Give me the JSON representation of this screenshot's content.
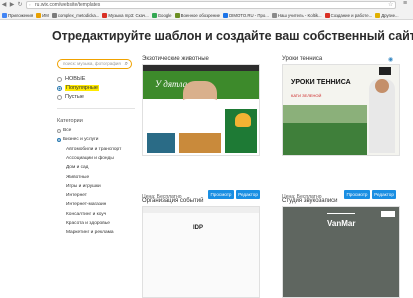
{
  "browser": {
    "url": "ru.wix.com/website/templates",
    "bookmarks": [
      {
        "label": "Приложения",
        "color": "#4285f4"
      },
      {
        "label": "ИМ",
        "color": "#e8a000"
      },
      {
        "label": "complex_metodicka...",
        "color": "#7b7b7b"
      },
      {
        "label": "Музыка mp3: Скач...",
        "color": "#d93025"
      },
      {
        "label": "Google",
        "color": "#34a853"
      },
      {
        "label": "Военное обозрение",
        "color": "#6b8e23"
      },
      {
        "label": "DIMOTO.RU - Про...",
        "color": "#1a73e8"
      },
      {
        "label": "Наш учитель - Koltik...",
        "color": "#8a8a8a"
      },
      {
        "label": "Создание и работе...",
        "color": "#d93025"
      },
      {
        "label": "Другие...",
        "color": "#e0b000"
      }
    ]
  },
  "headline": "Отредактируйте шаблон и создайте ваш собственный сайт!",
  "sidebar": {
    "search_placeholder": "поиск: музыка, фотография",
    "filters": [
      {
        "label": "НОВЫЕ",
        "selected": false,
        "highlight": false
      },
      {
        "label": "Популярные",
        "selected": true,
        "highlight": true
      },
      {
        "label": "Пустые",
        "selected": false,
        "highlight": false
      }
    ],
    "categories_title": "Категории",
    "categories": [
      {
        "label": "Все",
        "level": 0,
        "selected": false
      },
      {
        "label": "Бизнес и услуги",
        "level": 0,
        "selected": true
      },
      {
        "label": "Автомобили и транспорт",
        "level": 1
      },
      {
        "label": "Ассоциации и фонды",
        "level": 1
      },
      {
        "label": "Дом и сад",
        "level": 1
      },
      {
        "label": "Животные",
        "level": 1
      },
      {
        "label": "Игры и игрушки",
        "level": 1
      },
      {
        "label": "Интернет",
        "level": 1
      },
      {
        "label": "Интернет-магазин",
        "level": 1
      },
      {
        "label": "Консалтинг и коуч",
        "level": 1
      },
      {
        "label": "Красота и здоровье",
        "level": 1
      },
      {
        "label": "Маркетинг и реклама",
        "level": 1
      }
    ]
  },
  "templates": [
    {
      "title": "Экзотические животные",
      "price": "Цена: Бесплатно",
      "view_label": "Просмотр",
      "edit_label": "Редактор",
      "thumb_title": "У дятла"
    },
    {
      "title": "Уроки тенниса",
      "price": "Цена: Бесплатно",
      "view_label": "Просмотр",
      "edit_label": "Редактор",
      "thumb_title": "УРОКИ ТЕННИСА",
      "thumb_sub": "КАТИ ЗЕЛЕНОЙ"
    },
    {
      "title": "Организация событий",
      "thumb_title": "IDP"
    },
    {
      "title": "Студия звукозаписи",
      "thumb_title": "VanMar"
    }
  ]
}
